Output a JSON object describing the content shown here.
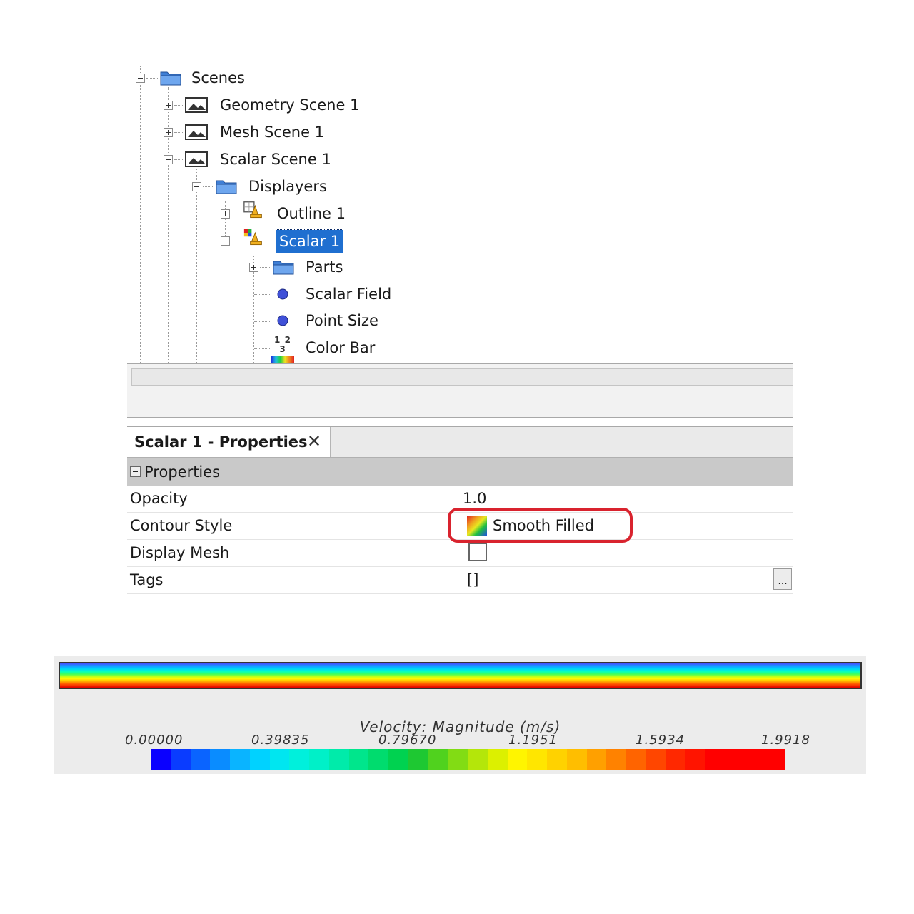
{
  "tree": {
    "items": [
      {
        "label": "Scenes",
        "icon": "folder-icon"
      },
      {
        "label": "Geometry Scene 1",
        "icon": "scene-image-icon"
      },
      {
        "label": "Mesh Scene 1",
        "icon": "scene-image-icon"
      },
      {
        "label": "Scalar Scene 1",
        "icon": "scene-image-icon"
      },
      {
        "label": "Displayers",
        "icon": "folder-icon"
      },
      {
        "label": "Outline 1",
        "icon": "outline-displayer-icon"
      },
      {
        "label": "Scalar 1",
        "icon": "scalar-displayer-icon",
        "selected": true
      },
      {
        "label": "Parts",
        "icon": "folder-icon"
      },
      {
        "label": "Scalar Field",
        "icon": "property-dot-icon"
      },
      {
        "label": "Point Size",
        "icon": "property-dot-icon"
      },
      {
        "label": "Color Bar",
        "icon": "color-bar-icon"
      }
    ],
    "colorbar_icon_digits": "1 2 3"
  },
  "properties": {
    "tab_title": "Scalar 1 - Properties",
    "tab_close": "✕",
    "section_label": "Properties",
    "rows": [
      {
        "name": "Opacity",
        "value": "1.0"
      },
      {
        "name": "Contour Style",
        "value": "Smooth Filled"
      },
      {
        "name": "Display Mesh",
        "value": ""
      },
      {
        "name": "Tags",
        "value": "[]"
      }
    ],
    "tags_button_label": "...",
    "display_mesh_checked": false
  },
  "legend": {
    "title": "Velocity: Magnitude (m/s)",
    "ticks": [
      "0.00000",
      "0.39835",
      "0.79670",
      "1.1951",
      "1.5934",
      "1.9918"
    ],
    "strip_colors": [
      "#0a00ff",
      "#0a3cff",
      "#0a64ff",
      "#0a8cff",
      "#0ab4ff",
      "#00d2ff",
      "#00e6f0",
      "#00f0dc",
      "#00f0c8",
      "#00ebaa",
      "#00e68c",
      "#00dc6e",
      "#00d250",
      "#1ec832",
      "#50d21e",
      "#82dc14",
      "#b4e60a",
      "#dcf000",
      "#fff500",
      "#ffe600",
      "#ffd200",
      "#ffbe00",
      "#ffa000",
      "#ff8200",
      "#ff6400",
      "#ff4600",
      "#ff2800",
      "#ff1400",
      "#ff0000",
      "#ff0000",
      "#ff0000",
      "#ff0000"
    ],
    "highlight_color": "#d9232e",
    "selection_color": "#1f6fd0"
  }
}
